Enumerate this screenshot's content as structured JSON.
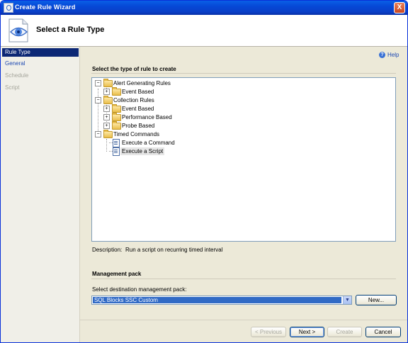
{
  "window": {
    "title": "Create Rule Wizard",
    "close_glyph": "X"
  },
  "header": {
    "title": "Select a Rule Type",
    "icon": "rule-eye-icon"
  },
  "sidebar": {
    "items": [
      {
        "label": "Rule Type",
        "state": "active"
      },
      {
        "label": "General",
        "state": "link"
      },
      {
        "label": "Schedule",
        "state": "disabled"
      },
      {
        "label": "Script",
        "state": "disabled"
      }
    ]
  },
  "help": {
    "label": "Help",
    "glyph": "?"
  },
  "main": {
    "section_title": "Select the type of rule to create",
    "tree": [
      {
        "label": "Alert Generating Rules",
        "toggle": "−",
        "type": "folder"
      },
      {
        "label": "Event Based",
        "toggle": "+",
        "type": "folder"
      },
      {
        "label": "Collection Rules",
        "toggle": "−",
        "type": "folder"
      },
      {
        "label": "Event Based",
        "toggle": "+",
        "type": "folder"
      },
      {
        "label": "Performance Based",
        "toggle": "+",
        "type": "folder"
      },
      {
        "label": "Probe Based",
        "toggle": "+",
        "type": "folder"
      },
      {
        "label": "Timed Commands",
        "toggle": "−",
        "type": "folder"
      },
      {
        "label": "Execute a Command",
        "toggle": "",
        "type": "script"
      },
      {
        "label": "Execute a Script",
        "toggle": "",
        "type": "script",
        "selected": true
      }
    ],
    "description_label": "Description:",
    "description_text": "Run a script on recurring timed interval"
  },
  "management": {
    "section_title": "Management pack",
    "select_label": "Select destination management pack:",
    "selected_value": "SQL Blocks SSC Custom",
    "arrow_glyph": "▼",
    "new_button": "New..."
  },
  "footer": {
    "previous": "< Previous",
    "next": "Next >",
    "create": "Create",
    "cancel": "Cancel"
  },
  "colors": {
    "accent": "#0c2775",
    "link": "#1f4ab3",
    "titlebar": "#0a5fe6"
  }
}
